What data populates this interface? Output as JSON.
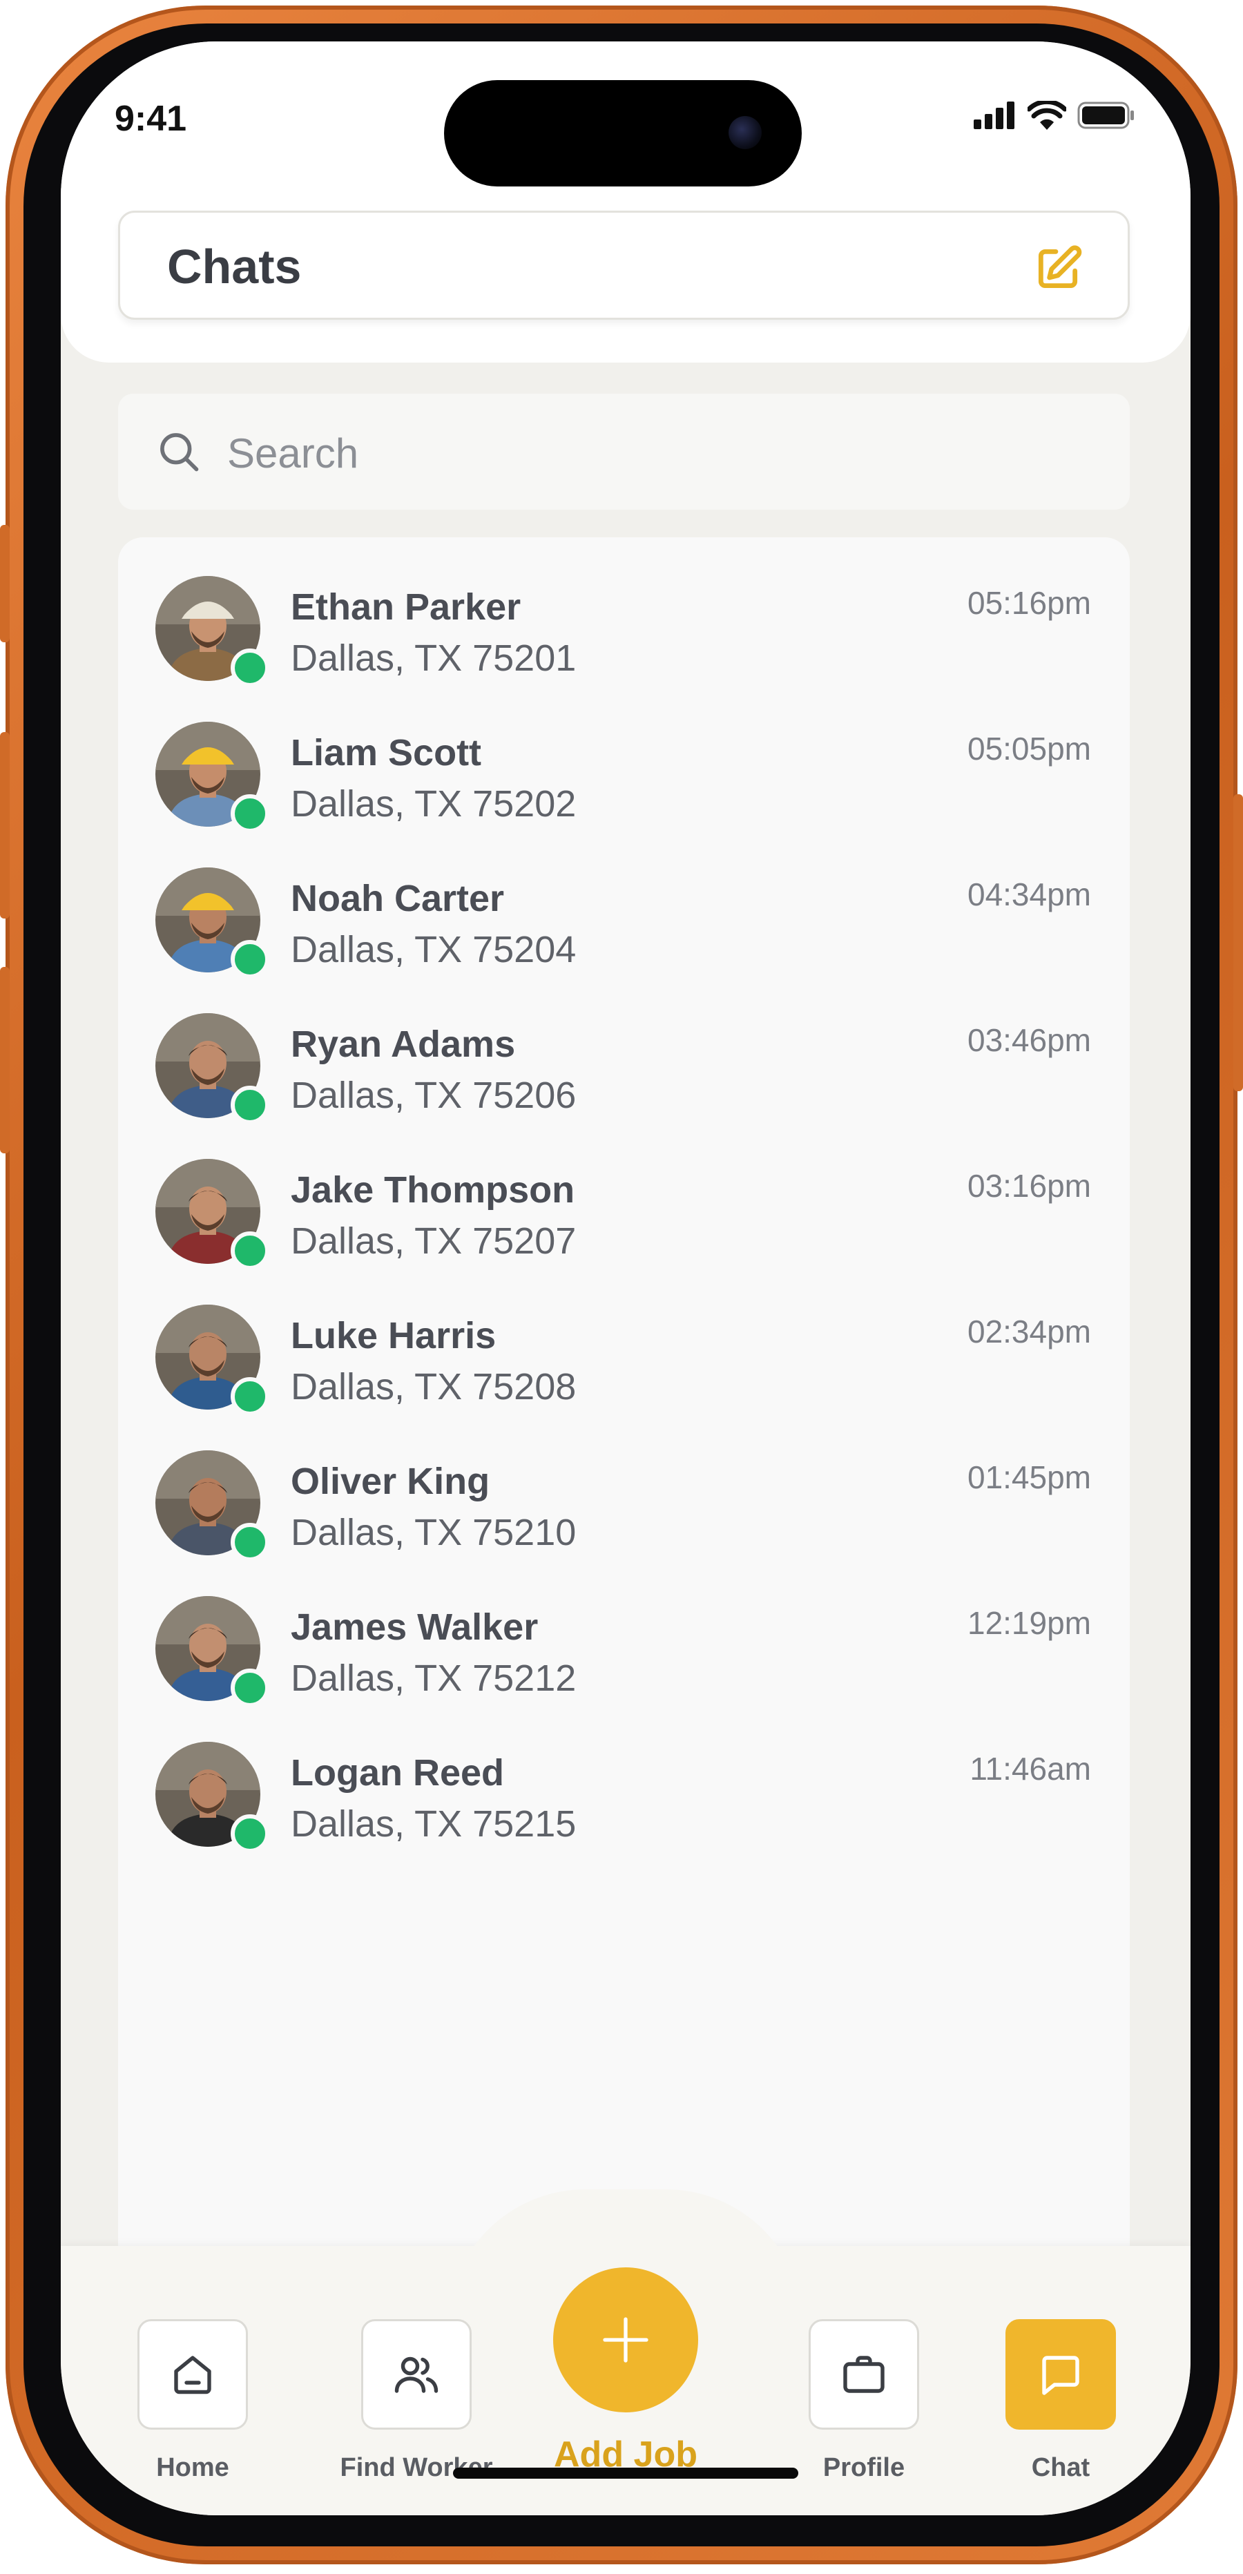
{
  "status_bar": {
    "time": "9:41"
  },
  "header": {
    "title": "Chats",
    "edit_icon": "edit-square-icon"
  },
  "search": {
    "placeholder": "Search",
    "icon": "search-icon"
  },
  "chats": [
    {
      "name": "Ethan Parker",
      "location": "Dallas, TX 75201",
      "time": "05:16pm",
      "online": true,
      "shirt": "#8c6b45",
      "skin": "#c89371",
      "hat": "#e9e4d6"
    },
    {
      "name": "Liam Scott",
      "location": "Dallas, TX 75202",
      "time": "05:05pm",
      "online": true,
      "shirt": "#6c8fb8",
      "skin": "#c58d6b",
      "hat": "#f2c22b"
    },
    {
      "name": "Noah Carter",
      "location": "Dallas, TX 75204",
      "time": "04:34pm",
      "online": true,
      "shirt": "#4f7fb5",
      "skin": "#b98262",
      "hat": "#f2c22b"
    },
    {
      "name": "Ryan Adams",
      "location": "Dallas, TX 75206",
      "time": "03:46pm",
      "online": true,
      "shirt": "#3f5d88",
      "skin": "#c08b6c",
      "hat": ""
    },
    {
      "name": "Jake Thompson",
      "location": "Dallas, TX 75207",
      "time": "03:16pm",
      "online": true,
      "shirt": "#8a2e2e",
      "skin": "#c4906f",
      "hat": ""
    },
    {
      "name": "Luke Harris",
      "location": "Dallas, TX 75208",
      "time": "02:34pm",
      "online": true,
      "shirt": "#2f5c8f",
      "skin": "#b98566",
      "hat": ""
    },
    {
      "name": "Oliver King",
      "location": "Dallas, TX 75210",
      "time": "01:45pm",
      "online": true,
      "shirt": "#4a5568",
      "skin": "#b47c5c",
      "hat": ""
    },
    {
      "name": "James Walker",
      "location": "Dallas, TX 75212",
      "time": "12:19pm",
      "online": true,
      "shirt": "#355f95",
      "skin": "#c28f70",
      "hat": ""
    },
    {
      "name": "Logan Reed",
      "location": "Dallas, TX 75215",
      "time": "11:46am",
      "online": true,
      "shirt": "#2a2a2a",
      "skin": "#b88364",
      "hat": ""
    }
  ],
  "nav": {
    "home": "Home",
    "find_worker": "Find Worker",
    "add_job": "Add Job",
    "profile": "Profile",
    "chat": "Chat"
  },
  "colors": {
    "accent": "#f0b62c",
    "online": "#1fb86a",
    "frame": "#e07a35"
  }
}
